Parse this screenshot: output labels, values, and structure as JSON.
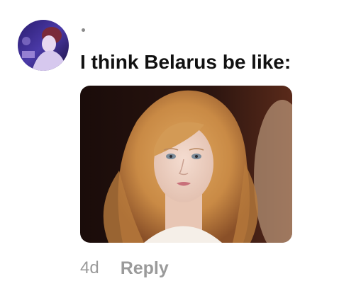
{
  "comment": {
    "avatar_icon": "user-avatar",
    "text": "I think Belarus be like:",
    "media_icon": "attached-photo",
    "timestamp": "4d",
    "reply_label": "Reply"
  },
  "colors": {
    "text_primary": "#111111",
    "text_secondary": "#9a9a9a",
    "background": "#ffffff"
  }
}
